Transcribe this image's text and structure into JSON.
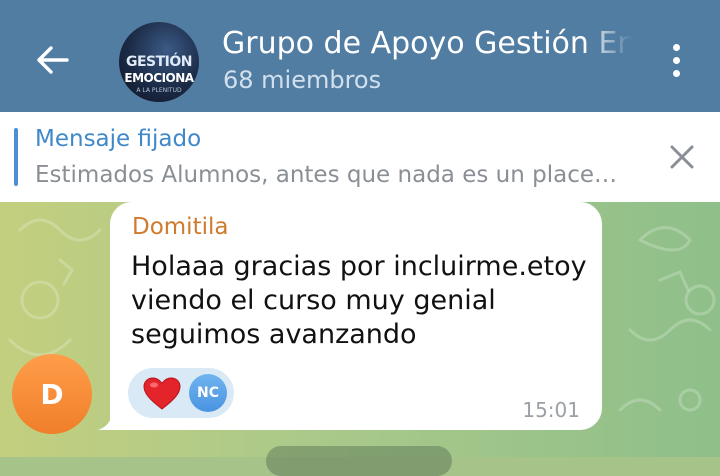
{
  "header": {
    "title": "Grupo de Apoyo Gestión Emocional",
    "subtitle": "68 miembros",
    "avatar_text": {
      "line1": "GESTIÓN",
      "line2": "EMOCIONA",
      "line3": "A LA PLENITUD"
    },
    "icons": {
      "back": "arrow-left-icon",
      "menu": "more-vertical-icon"
    }
  },
  "pinned": {
    "label": "Mensaje fijado",
    "text": "Estimados Alumnos, antes que nada es un place…",
    "close_icon": "close-icon"
  },
  "message": {
    "sender_initial": "D",
    "sender_name": "Domitila",
    "text": "Holaaa gracias por incluirme.etoy viendo el curso muy genial seguimos avanzando",
    "reaction_emoji": "heart-icon",
    "reaction_user": "NC",
    "time": "15:01"
  },
  "colors": {
    "header_bg": "#517da2",
    "accent": "#3f88c9",
    "sender_name": "#d07a2d",
    "avatar_orange": "#f07f2a"
  }
}
